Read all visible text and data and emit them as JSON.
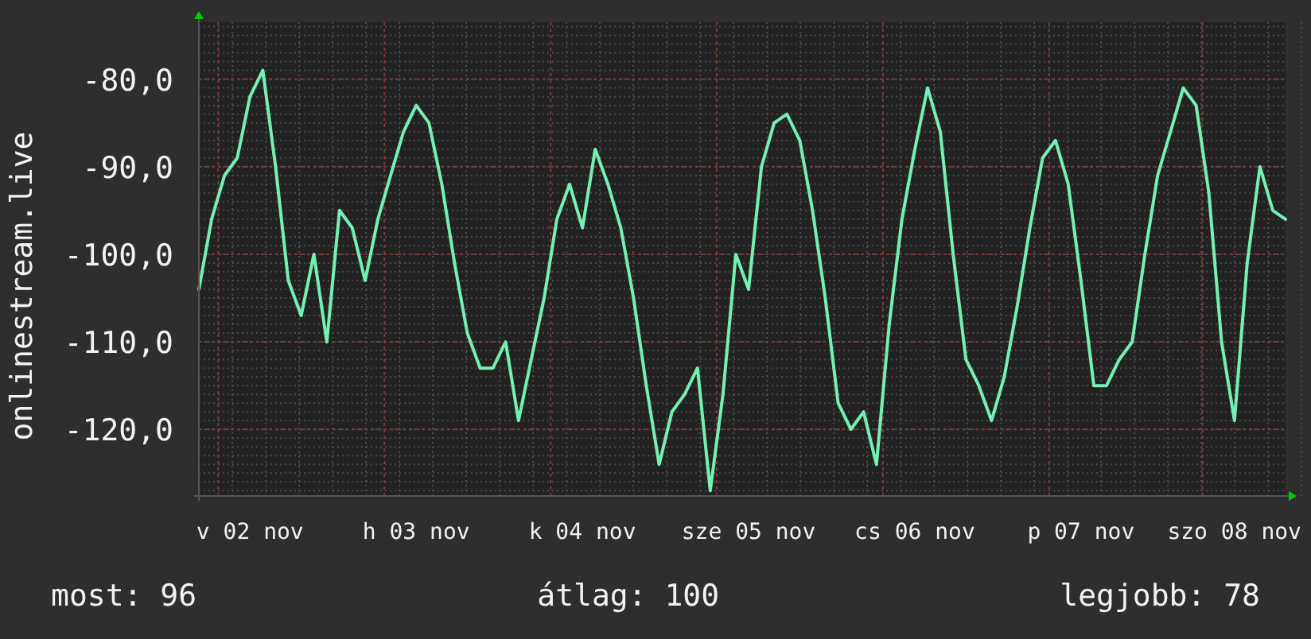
{
  "chart": {
    "chart_data": {
      "type": "line",
      "ylabel": "onlinestream.live",
      "yticks": [
        {
          "value": -80,
          "label": "-80,0"
        },
        {
          "value": -90,
          "label": "-90,0"
        },
        {
          "value": -100,
          "label": "-100,0"
        },
        {
          "value": -110,
          "label": "-110,0"
        },
        {
          "value": -120,
          "label": "-120,0"
        }
      ],
      "ylim": [
        -127.6,
        -73.5
      ],
      "grid": true,
      "categories": [
        null,
        null,
        null,
        null,
        "v 02 nov",
        null,
        null,
        null,
        null,
        null,
        null,
        null,
        null,
        null,
        null,
        null,
        null,
        "h 03 nov",
        null,
        null,
        null,
        null,
        null,
        null,
        null,
        null,
        null,
        null,
        null,
        null,
        "k 04 nov",
        null,
        null,
        null,
        null,
        null,
        null,
        null,
        null,
        null,
        null,
        null,
        null,
        "sze 05 nov",
        null,
        null,
        null,
        null,
        null,
        null,
        null,
        null,
        null,
        null,
        null,
        null,
        "cs 06 nov",
        null,
        null,
        null,
        null,
        null,
        null,
        null,
        null,
        null,
        null,
        null,
        null,
        "p 07 nov",
        null,
        null,
        null,
        null,
        null,
        null,
        null,
        null,
        null,
        null,
        null,
        "szo 08 nov",
        null,
        null,
        null,
        null
      ],
      "series": [
        {
          "color": "#74f0b4",
          "values": [
            -104,
            -96,
            -91,
            -89,
            -82,
            -79,
            -90,
            -103,
            -107,
            -100,
            -110,
            -95,
            -97,
            -103,
            -96,
            -91,
            -86,
            -83,
            -85,
            -92,
            -101,
            -109,
            -113,
            -113,
            -110,
            -119,
            -112,
            -105,
            -96,
            -92,
            -97,
            -88,
            -92,
            -97,
            -105,
            -115,
            -124,
            -118,
            -116,
            -113,
            -127,
            -116,
            -100,
            -104,
            -90,
            -85,
            -84,
            -87,
            -95,
            -105,
            -117,
            -120,
            -118,
            -124,
            -108,
            -96,
            -88,
            -81,
            -86,
            -100,
            -112,
            -115,
            -119,
            -114,
            -106,
            -97,
            -89,
            -87,
            -92,
            -103,
            -115,
            -115,
            -112,
            -110,
            -100,
            -91,
            -86,
            -81,
            -83,
            -93,
            -110,
            -119,
            -101,
            -90,
            -95,
            -96
          ]
        }
      ]
    }
  },
  "legend": [
    {
      "label": "most: 96"
    },
    {
      "label": "átlag: 100"
    },
    {
      "label": "legjobb: 78"
    }
  ]
}
